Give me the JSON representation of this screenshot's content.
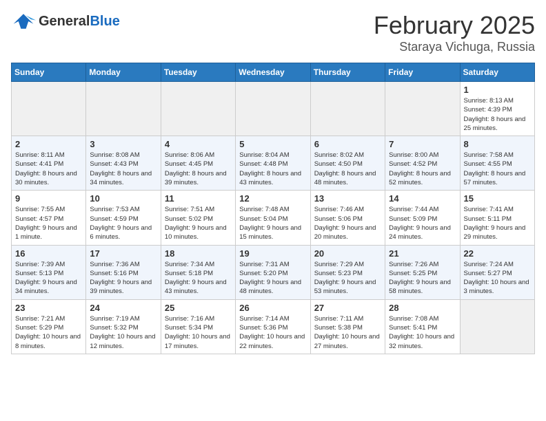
{
  "header": {
    "logo_general": "General",
    "logo_blue": "Blue",
    "month": "February 2025",
    "location": "Staraya Vichuga, Russia"
  },
  "weekdays": [
    "Sunday",
    "Monday",
    "Tuesday",
    "Wednesday",
    "Thursday",
    "Friday",
    "Saturday"
  ],
  "weeks": [
    [
      {
        "day": "",
        "empty": true
      },
      {
        "day": "",
        "empty": true
      },
      {
        "day": "",
        "empty": true
      },
      {
        "day": "",
        "empty": true
      },
      {
        "day": "",
        "empty": true
      },
      {
        "day": "",
        "empty": true
      },
      {
        "day": "1",
        "sunrise": "Sunrise: 8:13 AM",
        "sunset": "Sunset: 4:39 PM",
        "daylight": "Daylight: 8 hours and 25 minutes."
      }
    ],
    [
      {
        "day": "2",
        "sunrise": "Sunrise: 8:11 AM",
        "sunset": "Sunset: 4:41 PM",
        "daylight": "Daylight: 8 hours and 30 minutes."
      },
      {
        "day": "3",
        "sunrise": "Sunrise: 8:08 AM",
        "sunset": "Sunset: 4:43 PM",
        "daylight": "Daylight: 8 hours and 34 minutes."
      },
      {
        "day": "4",
        "sunrise": "Sunrise: 8:06 AM",
        "sunset": "Sunset: 4:45 PM",
        "daylight": "Daylight: 8 hours and 39 minutes."
      },
      {
        "day": "5",
        "sunrise": "Sunrise: 8:04 AM",
        "sunset": "Sunset: 4:48 PM",
        "daylight": "Daylight: 8 hours and 43 minutes."
      },
      {
        "day": "6",
        "sunrise": "Sunrise: 8:02 AM",
        "sunset": "Sunset: 4:50 PM",
        "daylight": "Daylight: 8 hours and 48 minutes."
      },
      {
        "day": "7",
        "sunrise": "Sunrise: 8:00 AM",
        "sunset": "Sunset: 4:52 PM",
        "daylight": "Daylight: 8 hours and 52 minutes."
      },
      {
        "day": "8",
        "sunrise": "Sunrise: 7:58 AM",
        "sunset": "Sunset: 4:55 PM",
        "daylight": "Daylight: 8 hours and 57 minutes."
      }
    ],
    [
      {
        "day": "9",
        "sunrise": "Sunrise: 7:55 AM",
        "sunset": "Sunset: 4:57 PM",
        "daylight": "Daylight: 9 hours and 1 minute."
      },
      {
        "day": "10",
        "sunrise": "Sunrise: 7:53 AM",
        "sunset": "Sunset: 4:59 PM",
        "daylight": "Daylight: 9 hours and 6 minutes."
      },
      {
        "day": "11",
        "sunrise": "Sunrise: 7:51 AM",
        "sunset": "Sunset: 5:02 PM",
        "daylight": "Daylight: 9 hours and 10 minutes."
      },
      {
        "day": "12",
        "sunrise": "Sunrise: 7:48 AM",
        "sunset": "Sunset: 5:04 PM",
        "daylight": "Daylight: 9 hours and 15 minutes."
      },
      {
        "day": "13",
        "sunrise": "Sunrise: 7:46 AM",
        "sunset": "Sunset: 5:06 PM",
        "daylight": "Daylight: 9 hours and 20 minutes."
      },
      {
        "day": "14",
        "sunrise": "Sunrise: 7:44 AM",
        "sunset": "Sunset: 5:09 PM",
        "daylight": "Daylight: 9 hours and 24 minutes."
      },
      {
        "day": "15",
        "sunrise": "Sunrise: 7:41 AM",
        "sunset": "Sunset: 5:11 PM",
        "daylight": "Daylight: 9 hours and 29 minutes."
      }
    ],
    [
      {
        "day": "16",
        "sunrise": "Sunrise: 7:39 AM",
        "sunset": "Sunset: 5:13 PM",
        "daylight": "Daylight: 9 hours and 34 minutes."
      },
      {
        "day": "17",
        "sunrise": "Sunrise: 7:36 AM",
        "sunset": "Sunset: 5:16 PM",
        "daylight": "Daylight: 9 hours and 39 minutes."
      },
      {
        "day": "18",
        "sunrise": "Sunrise: 7:34 AM",
        "sunset": "Sunset: 5:18 PM",
        "daylight": "Daylight: 9 hours and 43 minutes."
      },
      {
        "day": "19",
        "sunrise": "Sunrise: 7:31 AM",
        "sunset": "Sunset: 5:20 PM",
        "daylight": "Daylight: 9 hours and 48 minutes."
      },
      {
        "day": "20",
        "sunrise": "Sunrise: 7:29 AM",
        "sunset": "Sunset: 5:23 PM",
        "daylight": "Daylight: 9 hours and 53 minutes."
      },
      {
        "day": "21",
        "sunrise": "Sunrise: 7:26 AM",
        "sunset": "Sunset: 5:25 PM",
        "daylight": "Daylight: 9 hours and 58 minutes."
      },
      {
        "day": "22",
        "sunrise": "Sunrise: 7:24 AM",
        "sunset": "Sunset: 5:27 PM",
        "daylight": "Daylight: 10 hours and 3 minutes."
      }
    ],
    [
      {
        "day": "23",
        "sunrise": "Sunrise: 7:21 AM",
        "sunset": "Sunset: 5:29 PM",
        "daylight": "Daylight: 10 hours and 8 minutes."
      },
      {
        "day": "24",
        "sunrise": "Sunrise: 7:19 AM",
        "sunset": "Sunset: 5:32 PM",
        "daylight": "Daylight: 10 hours and 12 minutes."
      },
      {
        "day": "25",
        "sunrise": "Sunrise: 7:16 AM",
        "sunset": "Sunset: 5:34 PM",
        "daylight": "Daylight: 10 hours and 17 minutes."
      },
      {
        "day": "26",
        "sunrise": "Sunrise: 7:14 AM",
        "sunset": "Sunset: 5:36 PM",
        "daylight": "Daylight: 10 hours and 22 minutes."
      },
      {
        "day": "27",
        "sunrise": "Sunrise: 7:11 AM",
        "sunset": "Sunset: 5:38 PM",
        "daylight": "Daylight: 10 hours and 27 minutes."
      },
      {
        "day": "28",
        "sunrise": "Sunrise: 7:08 AM",
        "sunset": "Sunset: 5:41 PM",
        "daylight": "Daylight: 10 hours and 32 minutes."
      },
      {
        "day": "",
        "empty": true
      }
    ]
  ]
}
